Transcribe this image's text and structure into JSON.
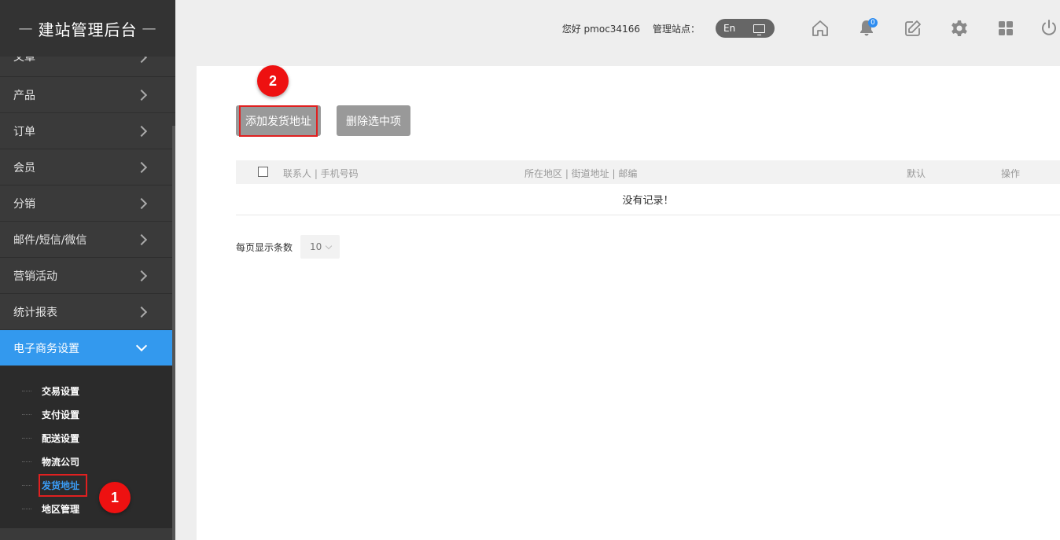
{
  "brand": {
    "title": "建站管理后台",
    "dash": "—"
  },
  "header": {
    "greeting": "您好 pmoc34166",
    "site_label": "管理站点：",
    "lang": "En",
    "notification_count": "0",
    "icons": [
      "home-icon",
      "bell-icon",
      "edit-icon",
      "gear-icon",
      "grid-icon",
      "power-icon"
    ]
  },
  "sidebar": {
    "items": [
      {
        "label": "文章"
      },
      {
        "label": "产品"
      },
      {
        "label": "订单"
      },
      {
        "label": "会员"
      },
      {
        "label": "分销"
      },
      {
        "label": "邮件/短信/微信"
      },
      {
        "label": "营销活动"
      },
      {
        "label": "统计报表"
      },
      {
        "label": "电子商务设置"
      }
    ],
    "submenu": [
      {
        "label": "交易设置"
      },
      {
        "label": "支付设置"
      },
      {
        "label": "配送设置"
      },
      {
        "label": "物流公司"
      },
      {
        "label": "发货地址"
      },
      {
        "label": "地区管理"
      }
    ]
  },
  "toolbar": {
    "add_label": "添加发货地址",
    "delete_label": "删除选中项"
  },
  "markers": {
    "one": "1",
    "two": "2"
  },
  "table": {
    "columns": [
      "联系人 | 手机号码",
      "所在地区 | 街道地址 | 邮编",
      "默认",
      "操作"
    ],
    "empty_text": "没有记录！"
  },
  "pager": {
    "label": "每页显示条数",
    "page_size": "10"
  },
  "colors": {
    "accent": "#3399ee",
    "sidebar_bg": "#3a3a3a",
    "marker": "#ee1111",
    "highlight_border": "#e02020"
  }
}
